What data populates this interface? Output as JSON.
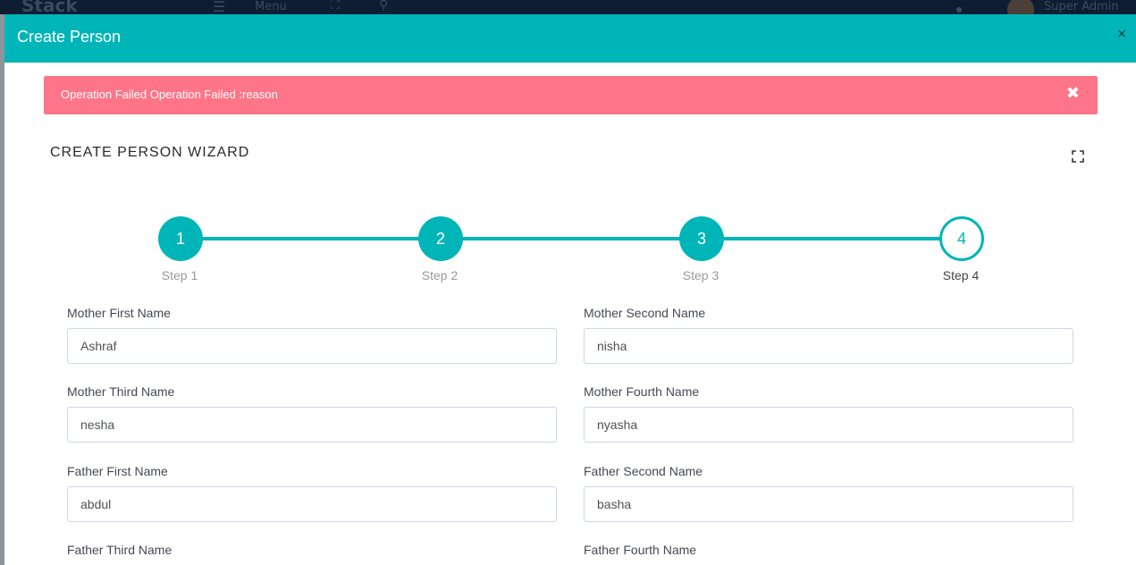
{
  "background": {
    "menu_label": "Menu",
    "user_name": "Super Admin"
  },
  "modal": {
    "title": "Create Person",
    "close_glyph": "×"
  },
  "alert": {
    "message": "Operation Failed Operation Failed :reason",
    "close_glyph": "✖"
  },
  "wizard": {
    "title": "CREATE PERSON WIZARD",
    "current_step": 4,
    "steps": [
      {
        "number": "1",
        "label": "Step 1"
      },
      {
        "number": "2",
        "label": "Step 2"
      },
      {
        "number": "3",
        "label": "Step 3"
      },
      {
        "number": "4",
        "label": "Step 4"
      }
    ]
  },
  "form": {
    "fields": [
      {
        "label": "Mother First Name",
        "value": "Ashraf"
      },
      {
        "label": "Mother Second Name",
        "value": "nisha"
      },
      {
        "label": "Mother Third Name",
        "value": "nesha"
      },
      {
        "label": "Mother Fourth Name",
        "value": "nyasha"
      },
      {
        "label": "Father First Name",
        "value": "abdul"
      },
      {
        "label": "Father Second Name",
        "value": "basha"
      },
      {
        "label": "Father Third Name",
        "value": ""
      },
      {
        "label": "Father Fourth Name",
        "value": ""
      }
    ]
  },
  "colors": {
    "accent": "#00b5b8",
    "alert": "#ff7588",
    "topbar": "#0f1d33"
  },
  "icons": [
    "menu-icon",
    "expand-icon",
    "search-icon",
    "close-icon",
    "fullscreen-icon"
  ]
}
